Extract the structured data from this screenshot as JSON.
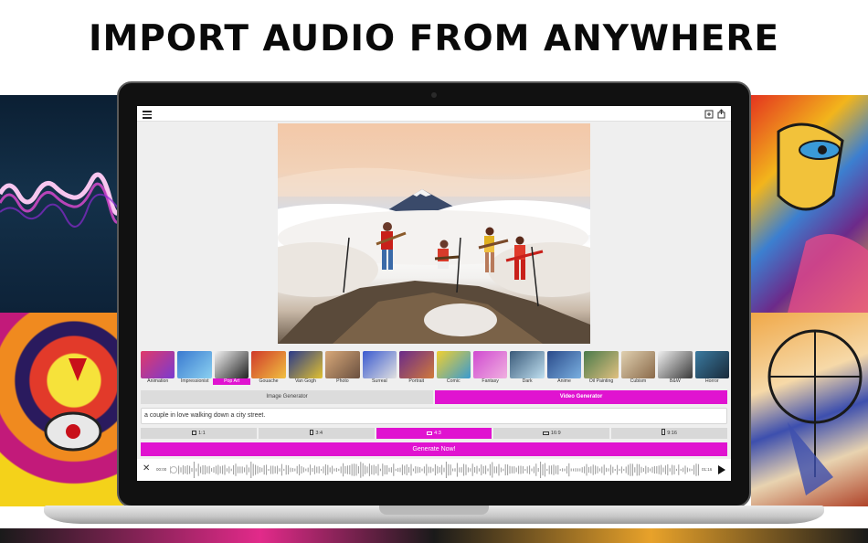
{
  "headline": "IMPORT AUDIO FROM ANYWHERE",
  "colors": {
    "accent": "#e013d0",
    "screen_bg": "#efefef"
  },
  "toolbar": {
    "menu_icon": "hamburger-menu-icon",
    "add_icon": "add-image-icon",
    "share_icon": "share-icon"
  },
  "styles": [
    {
      "label": "Animation",
      "colors": [
        "#e03a6a",
        "#7a3ad0"
      ]
    },
    {
      "label": "Impressionist",
      "colors": [
        "#3a7ad0",
        "#8ad0f0"
      ]
    },
    {
      "label": "Pop Art",
      "colors": [
        "#f2f2f2",
        "#222222"
      ],
      "selected": true
    },
    {
      "label": "Gouache",
      "colors": [
        "#d03a2a",
        "#f0c040"
      ]
    },
    {
      "label": "Van Gogh",
      "colors": [
        "#2a3a8a",
        "#e0c030"
      ]
    },
    {
      "label": "Photo",
      "colors": [
        "#d8a878",
        "#6a5040"
      ]
    },
    {
      "label": "Surreal",
      "colors": [
        "#3a5ad0",
        "#e0e0e0"
      ]
    },
    {
      "label": "Portrait",
      "colors": [
        "#6a2a8a",
        "#d07a3a"
      ]
    },
    {
      "label": "Comic",
      "colors": [
        "#f0d030",
        "#3a9ad0"
      ]
    },
    {
      "label": "Fantasy",
      "colors": [
        "#d04ad0",
        "#f0b0e0"
      ]
    },
    {
      "label": "Dark",
      "colors": [
        "#3a5a7a",
        "#c0e0f0"
      ]
    },
    {
      "label": "Anime",
      "colors": [
        "#2a4a8a",
        "#7ab0e0"
      ]
    },
    {
      "label": "Oil Painting",
      "colors": [
        "#4a7a4a",
        "#e0c080"
      ]
    },
    {
      "label": "Cubism",
      "colors": [
        "#e0d0b0",
        "#8a6a4a"
      ]
    },
    {
      "label": "B&W",
      "colors": [
        "#f0f0f0",
        "#3a3a3a"
      ]
    },
    {
      "label": "Horror",
      "colors": [
        "#3a7aa0",
        "#1a2a3a"
      ]
    }
  ],
  "mode": {
    "image_label": "Image Generator",
    "video_label": "Video Generator",
    "active": "video"
  },
  "prompt": {
    "value": "a couple in love walking down a city street."
  },
  "ratios": [
    {
      "label": "1:1",
      "w": 5,
      "h": 5
    },
    {
      "label": "3:4",
      "w": 4,
      "h": 6
    },
    {
      "label": "4:3",
      "w": 6,
      "h": 4,
      "selected": true
    },
    {
      "label": "16:9",
      "w": 7,
      "h": 4
    },
    {
      "label": "9:16",
      "w": 4,
      "h": 7
    }
  ],
  "generate_label": "Generate Now!",
  "player": {
    "current_time": "00:00",
    "total_time": "01:16",
    "progress": 0
  }
}
